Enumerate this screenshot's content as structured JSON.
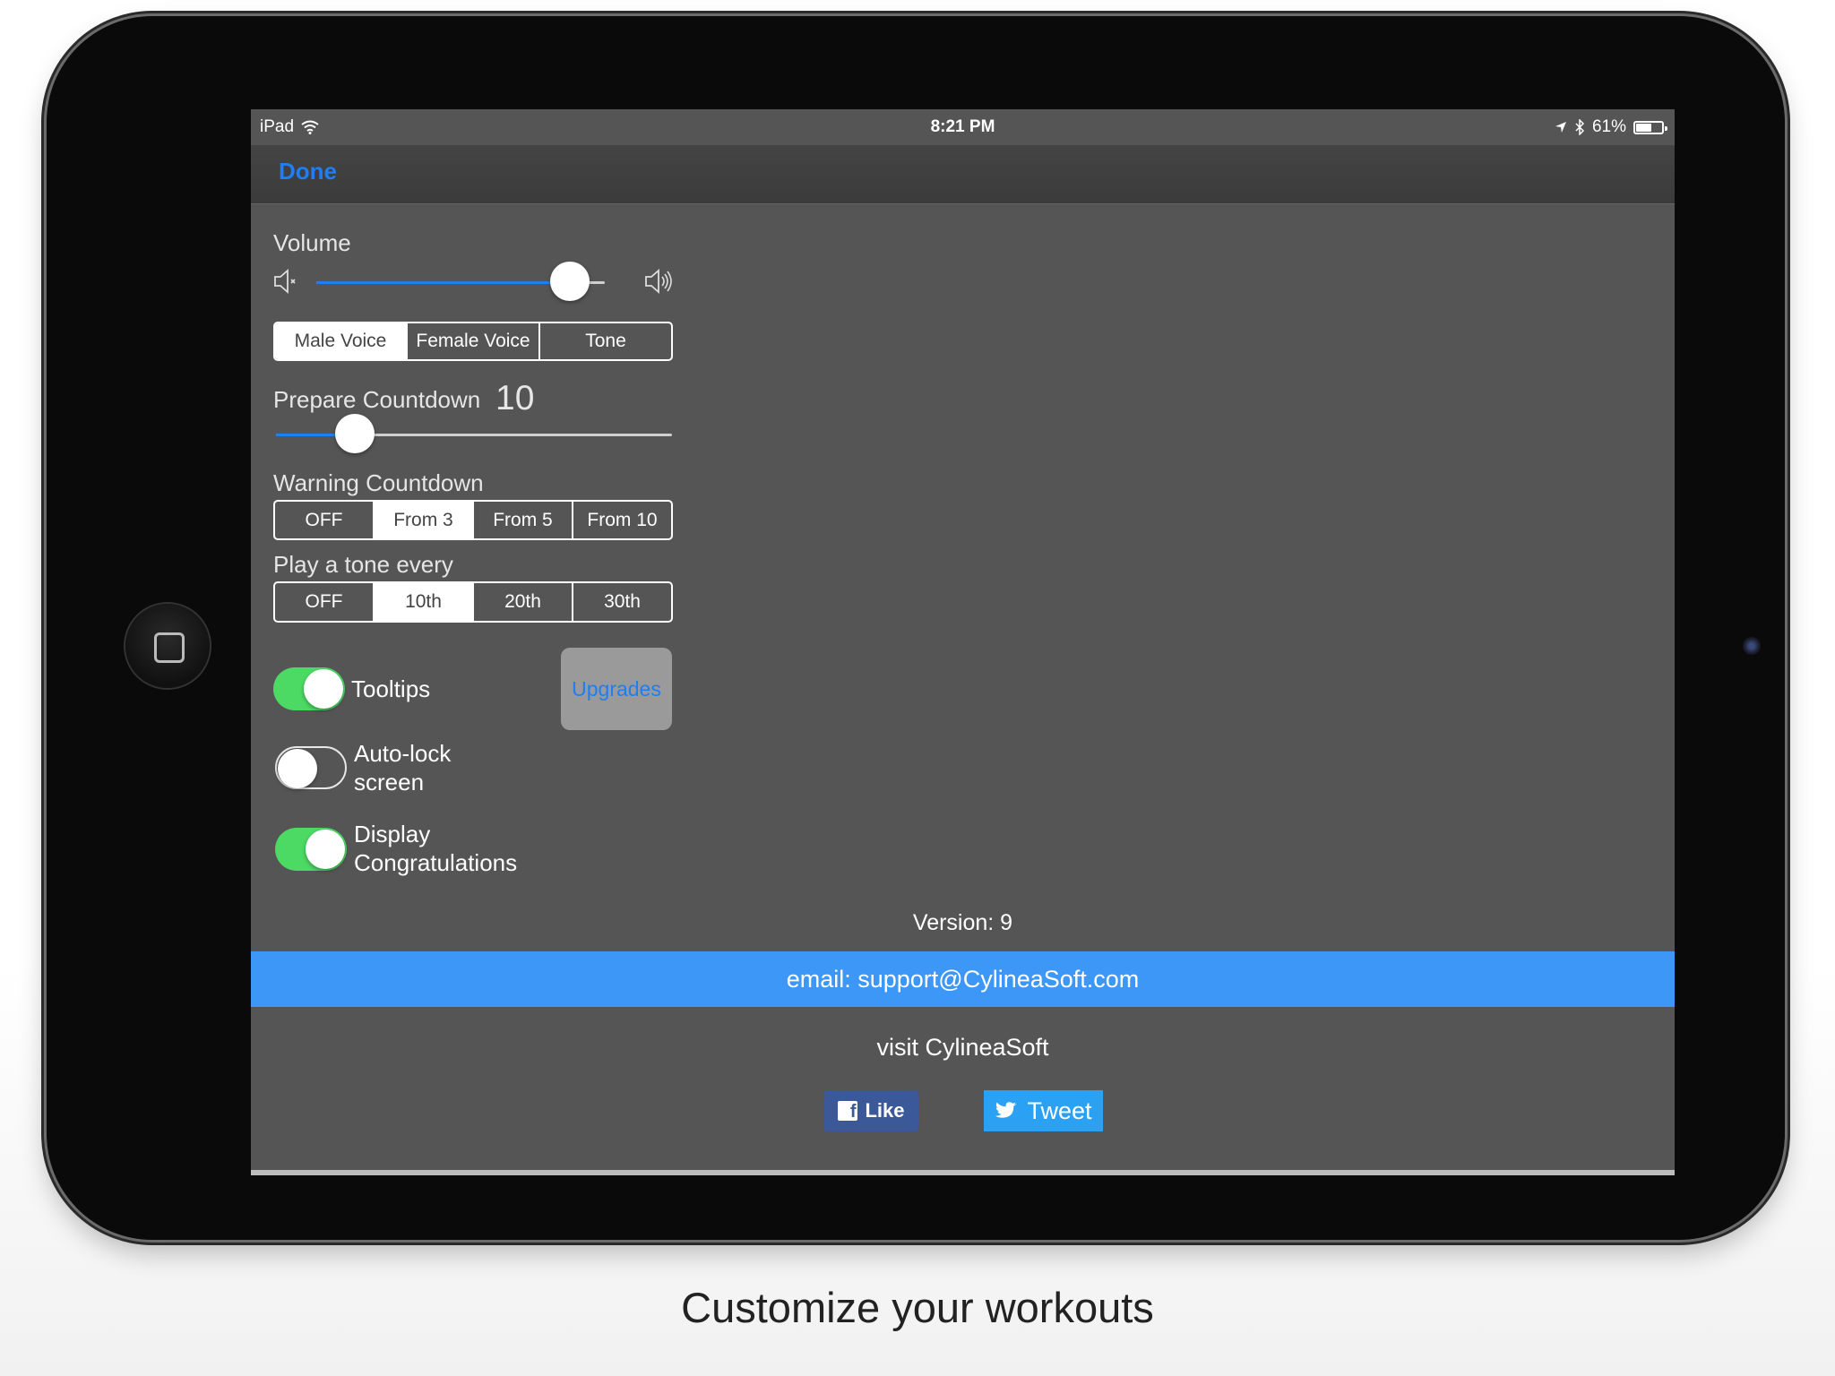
{
  "status_bar": {
    "device": "iPad",
    "time": "8:21 PM",
    "battery": "61%",
    "battery_level": 0.61
  },
  "nav": {
    "done_label": "Done"
  },
  "volume": {
    "label": "Volume",
    "value": 0.88
  },
  "voice": {
    "options": [
      "Male Voice",
      "Female Voice",
      "Tone"
    ],
    "selected": "Male Voice"
  },
  "prepare_countdown": {
    "label": "Prepare Countdown",
    "value": "10",
    "slider_value": 0.2
  },
  "warning_countdown": {
    "label": "Warning Countdown",
    "options": [
      "OFF",
      "From 3",
      "From 5",
      "From 10"
    ],
    "selected": "From 3"
  },
  "tone_every": {
    "label": "Play a tone every",
    "options": [
      "OFF",
      "10th",
      "20th",
      "30th"
    ],
    "selected": "10th"
  },
  "toggles": {
    "tooltips": {
      "label": "Tooltips",
      "on": true
    },
    "auto_lock": {
      "label_line1": "Auto-lock",
      "label_line2": "screen",
      "on": false
    },
    "congrats": {
      "label_line1": "Display",
      "label_line2": "Congratulations",
      "on": true
    }
  },
  "upgrades_label": "Upgrades",
  "version": "Version: 9",
  "email": "email: support@CylineaSoft.com",
  "visit": "visit CylineaSoft",
  "social": {
    "like_label": "Like",
    "tweet_label": "Tweet"
  },
  "colors": {
    "accent": "#1e7ef2",
    "toggle_on": "#4cd964",
    "email_bar": "#3d97f7",
    "facebook": "#3b5998",
    "twitter": "#2ba1f3"
  },
  "caption": "Customize your workouts"
}
